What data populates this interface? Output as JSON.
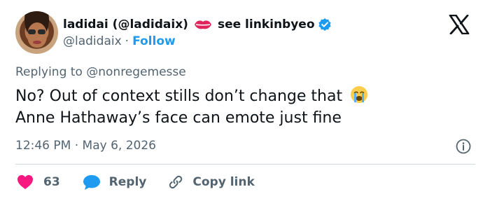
{
  "author": {
    "display_name": "ladidai (@ladidaix)",
    "link_text": "see linkinbyeo",
    "handle": "@ladidaix",
    "separator": "·",
    "follow_label": "Follow"
  },
  "reply_context": "Replying to @nonregemesse",
  "tweet": {
    "text": "No? Out of context stills don’t change that",
    "text_line2": "Anne Hathaway’s face can emote just fine",
    "emoji": "loudly-crying-face"
  },
  "timestamp": "12:46 PM · May 6, 2026",
  "actions": {
    "like_count": "63",
    "reply_label": "Reply",
    "copy_label": "Copy link"
  },
  "colors": {
    "accent": "#1d9bf0",
    "heart": "#f91880",
    "text_secondary": "#536471",
    "lips": "#e0245e"
  },
  "icons": [
    "avatar",
    "lips-icon",
    "verified-icon",
    "x-logo-icon",
    "info-icon",
    "heart-icon",
    "reply-bubble-icon",
    "link-icon"
  ]
}
